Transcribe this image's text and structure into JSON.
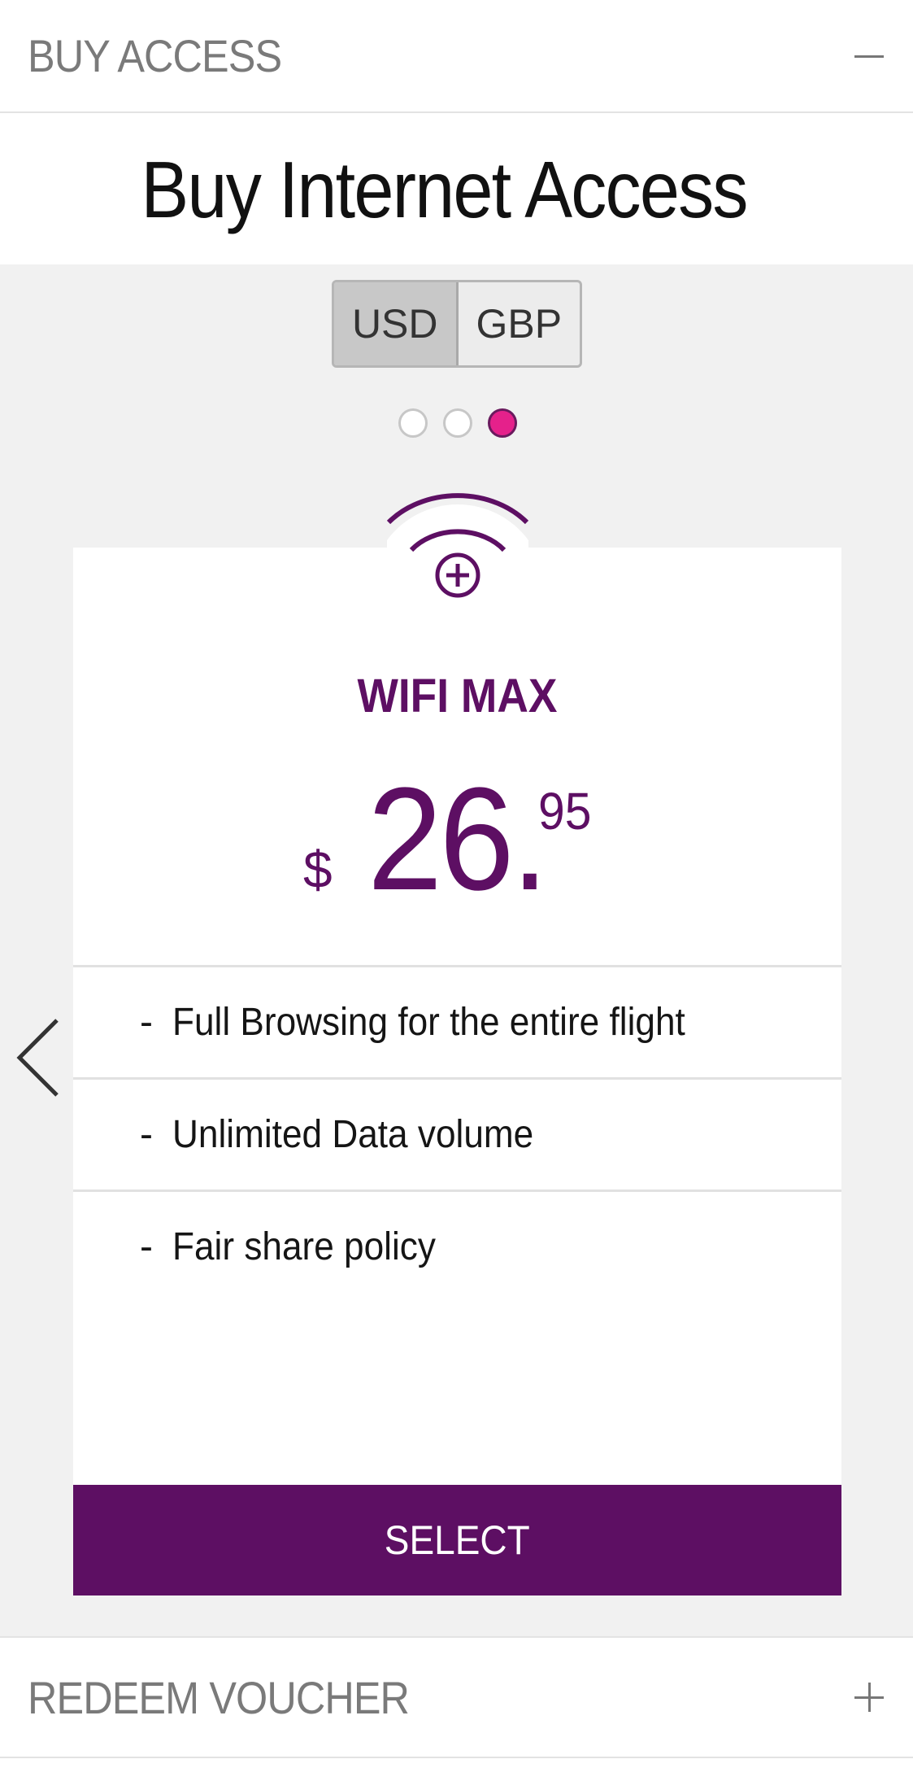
{
  "buy_access": {
    "header_label": "BUY ACCESS",
    "toggle_icon": "minus-icon"
  },
  "page": {
    "title": "Buy Internet Access"
  },
  "currency": {
    "options": [
      "USD",
      "GBP"
    ],
    "selected": "USD"
  },
  "carousel": {
    "slide_count": 3,
    "active_index": 2,
    "prev_icon": "chevron-left-icon"
  },
  "plan": {
    "icon": "wifi-plus-icon",
    "name": "WIFI MAX",
    "currency_symbol": "$",
    "price_main": "26.",
    "price_cents": "95",
    "features": [
      {
        "dash": "-",
        "text": "Full Browsing for the entire flight"
      },
      {
        "dash": "-",
        "text": "Unlimited Data volume"
      },
      {
        "dash": "-",
        "text": "Fair share policy"
      }
    ],
    "select_label": "SELECT"
  },
  "redeem_voucher": {
    "header_label": "REDEEM VOUCHER",
    "toggle_icon": "plus-icon"
  },
  "colors": {
    "brand_purple": "#5d0f63",
    "accent_magenta": "#e5218b",
    "grey_background": "#f1f1f1"
  }
}
